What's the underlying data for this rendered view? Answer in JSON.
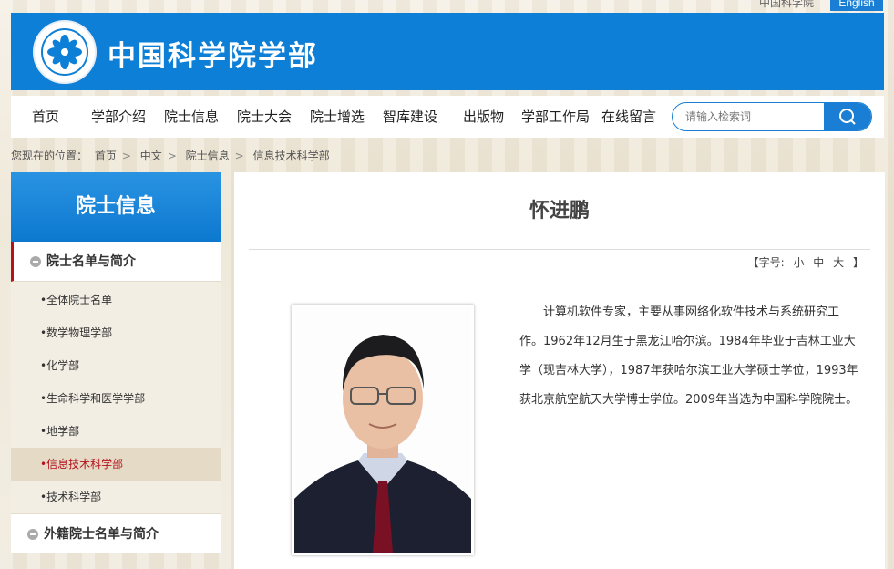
{
  "header": {
    "lang_cn": "中国科学院",
    "lang_en": "English",
    "site_title": "中国科学院学部"
  },
  "nav": {
    "items": [
      "首页",
      "学部介绍",
      "院士信息",
      "院士大会",
      "院士增选",
      "智库建设",
      "出版物",
      "学部工作局",
      "在线留言"
    ],
    "search_placeholder": "请输入检索词"
  },
  "breadcrumb": {
    "prefix": "您现在的位置：",
    "items": [
      "首页",
      "中文",
      "院士信息",
      "信息技术科学部"
    ]
  },
  "sidebar": {
    "title": "院士信息",
    "section1": "院士名单与简介",
    "items": [
      "•全体院士名单",
      "•数学物理学部",
      "•化学部",
      "•生命科学和医学学部",
      "•地学部",
      "•信息技术科学部",
      "•技术科学部"
    ],
    "active_index": 5,
    "section2": "外籍院士名单与简介"
  },
  "article": {
    "title": "怀进鹏",
    "font_label": "【字号:",
    "font_small": "小",
    "font_medium": "中",
    "font_large": "大",
    "font_close": "】",
    "bio": "计算机软件专家，主要从事网络化软件技术与系统研究工作。1962年12月生于黑龙江哈尔滨。1984年毕业于吉林工业大学（现吉林大学），1987年获哈尔滨工业大学硕士学位，1993年获北京航空航天大学博士学位。2009年当选为中国科学院院士。"
  },
  "colors": {
    "brand_blue": "#0d7fd6",
    "active_red": "#b5121b"
  }
}
